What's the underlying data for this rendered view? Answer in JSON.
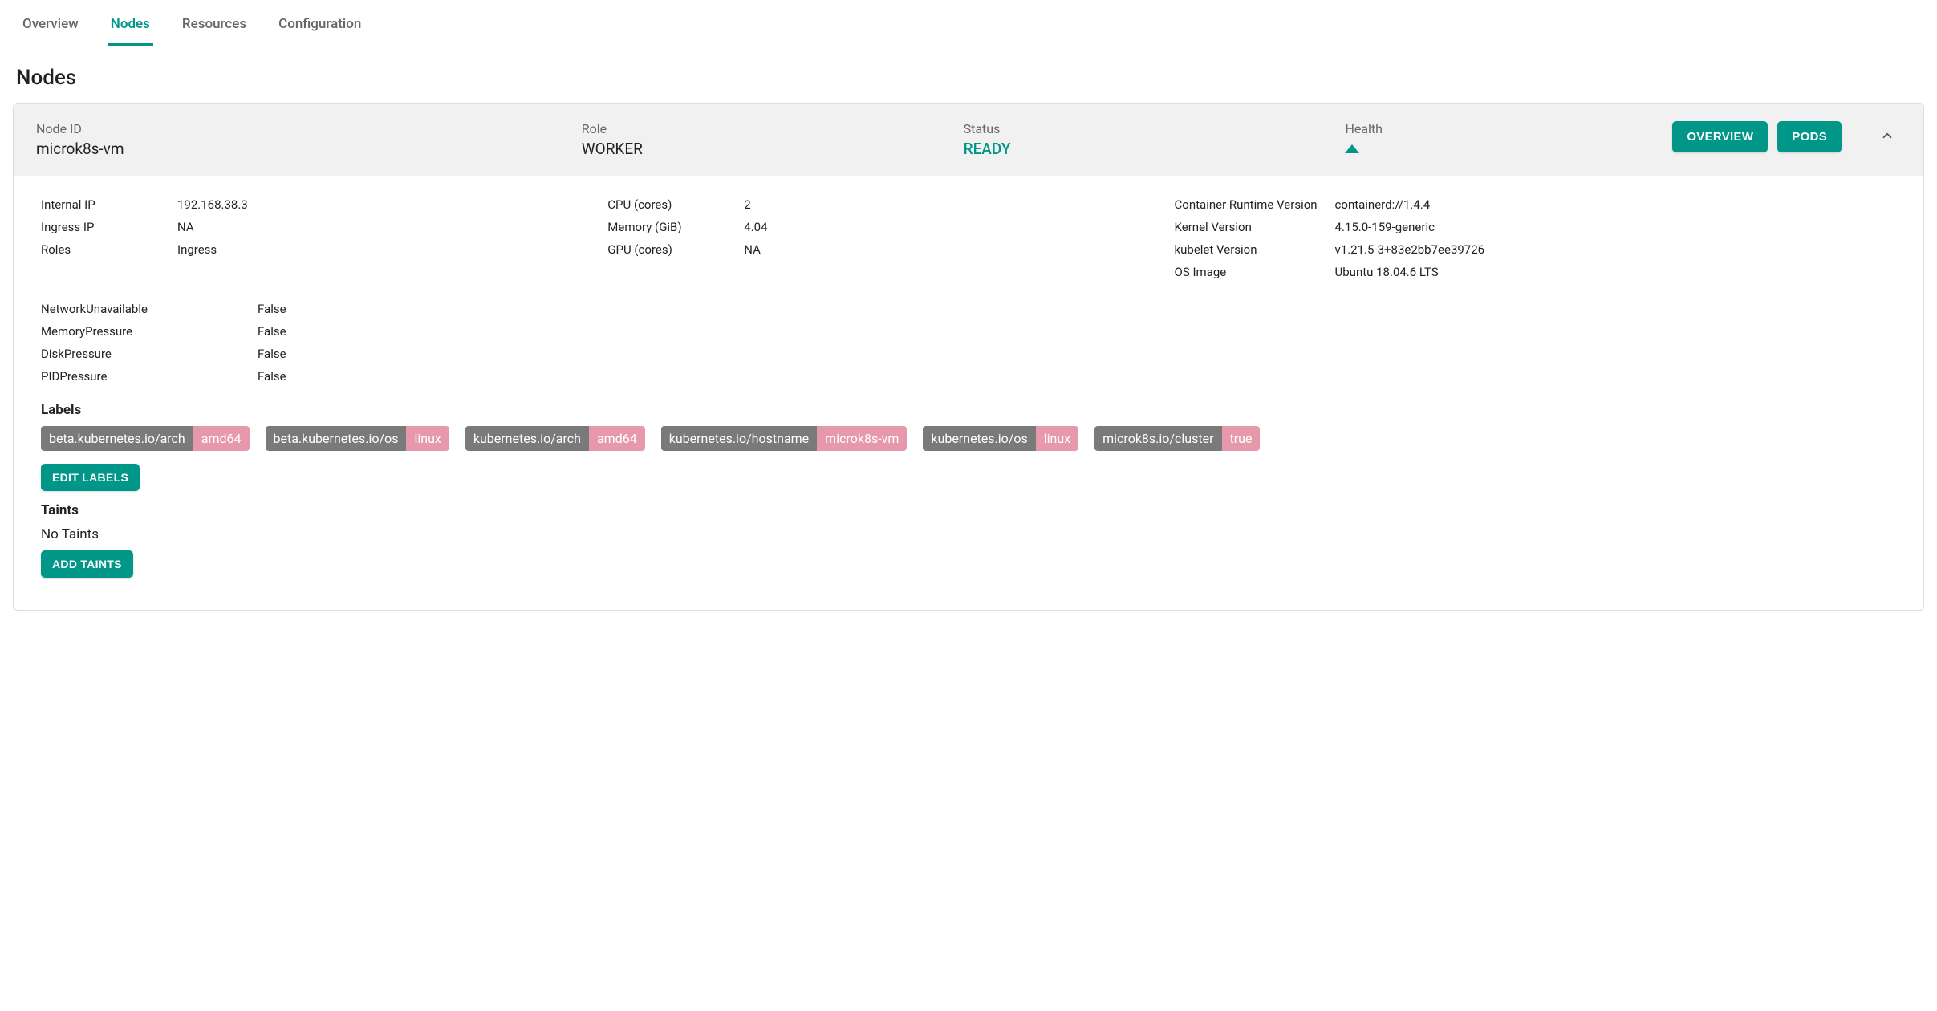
{
  "tabs": {
    "overview": "Overview",
    "nodes": "Nodes",
    "resources": "Resources",
    "configuration": "Configuration"
  },
  "page_title": "Nodes",
  "node_header": {
    "node_id_label": "Node ID",
    "node_id": "microk8s-vm",
    "role_label": "Role",
    "role": "WORKER",
    "status_label": "Status",
    "status": "READY",
    "health_label": "Health",
    "overview_btn": "OVERVIEW",
    "pods_btn": "PODS"
  },
  "details": {
    "left": [
      {
        "key": "Internal IP",
        "val": "192.168.38.3"
      },
      {
        "key": "Ingress IP",
        "val": "NA"
      },
      {
        "key": "Roles",
        "val": "Ingress"
      }
    ],
    "middle": [
      {
        "key": "CPU (cores)",
        "val": "2"
      },
      {
        "key": "Memory (GiB)",
        "val": "4.04"
      },
      {
        "key": "GPU (cores)",
        "val": "NA"
      }
    ],
    "right": [
      {
        "key": "Container Runtime Version",
        "val": "containerd://1.4.4"
      },
      {
        "key": "Kernel Version",
        "val": "4.15.0-159-generic"
      },
      {
        "key": "kubelet Version",
        "val": "v1.21.5-3+83e2bb7ee39726"
      },
      {
        "key": "OS Image",
        "val": "Ubuntu 18.04.6 LTS"
      }
    ]
  },
  "conditions": [
    {
      "key": "NetworkUnavailable",
      "val": "False"
    },
    {
      "key": "MemoryPressure",
      "val": "False"
    },
    {
      "key": "DiskPressure",
      "val": "False"
    },
    {
      "key": "PIDPressure",
      "val": "False"
    }
  ],
  "labels_heading": "Labels",
  "labels": [
    {
      "key": "beta.kubernetes.io/arch",
      "val": "amd64"
    },
    {
      "key": "beta.kubernetes.io/os",
      "val": "linux"
    },
    {
      "key": "kubernetes.io/arch",
      "val": "amd64"
    },
    {
      "key": "kubernetes.io/hostname",
      "val": "microk8s-vm"
    },
    {
      "key": "kubernetes.io/os",
      "val": "linux"
    },
    {
      "key": "microk8s.io/cluster",
      "val": "true"
    }
  ],
  "edit_labels_btn": "EDIT LABELS",
  "taints_heading": "Taints",
  "no_taints": "No Taints",
  "add_taints_btn": "ADD TAINTS"
}
